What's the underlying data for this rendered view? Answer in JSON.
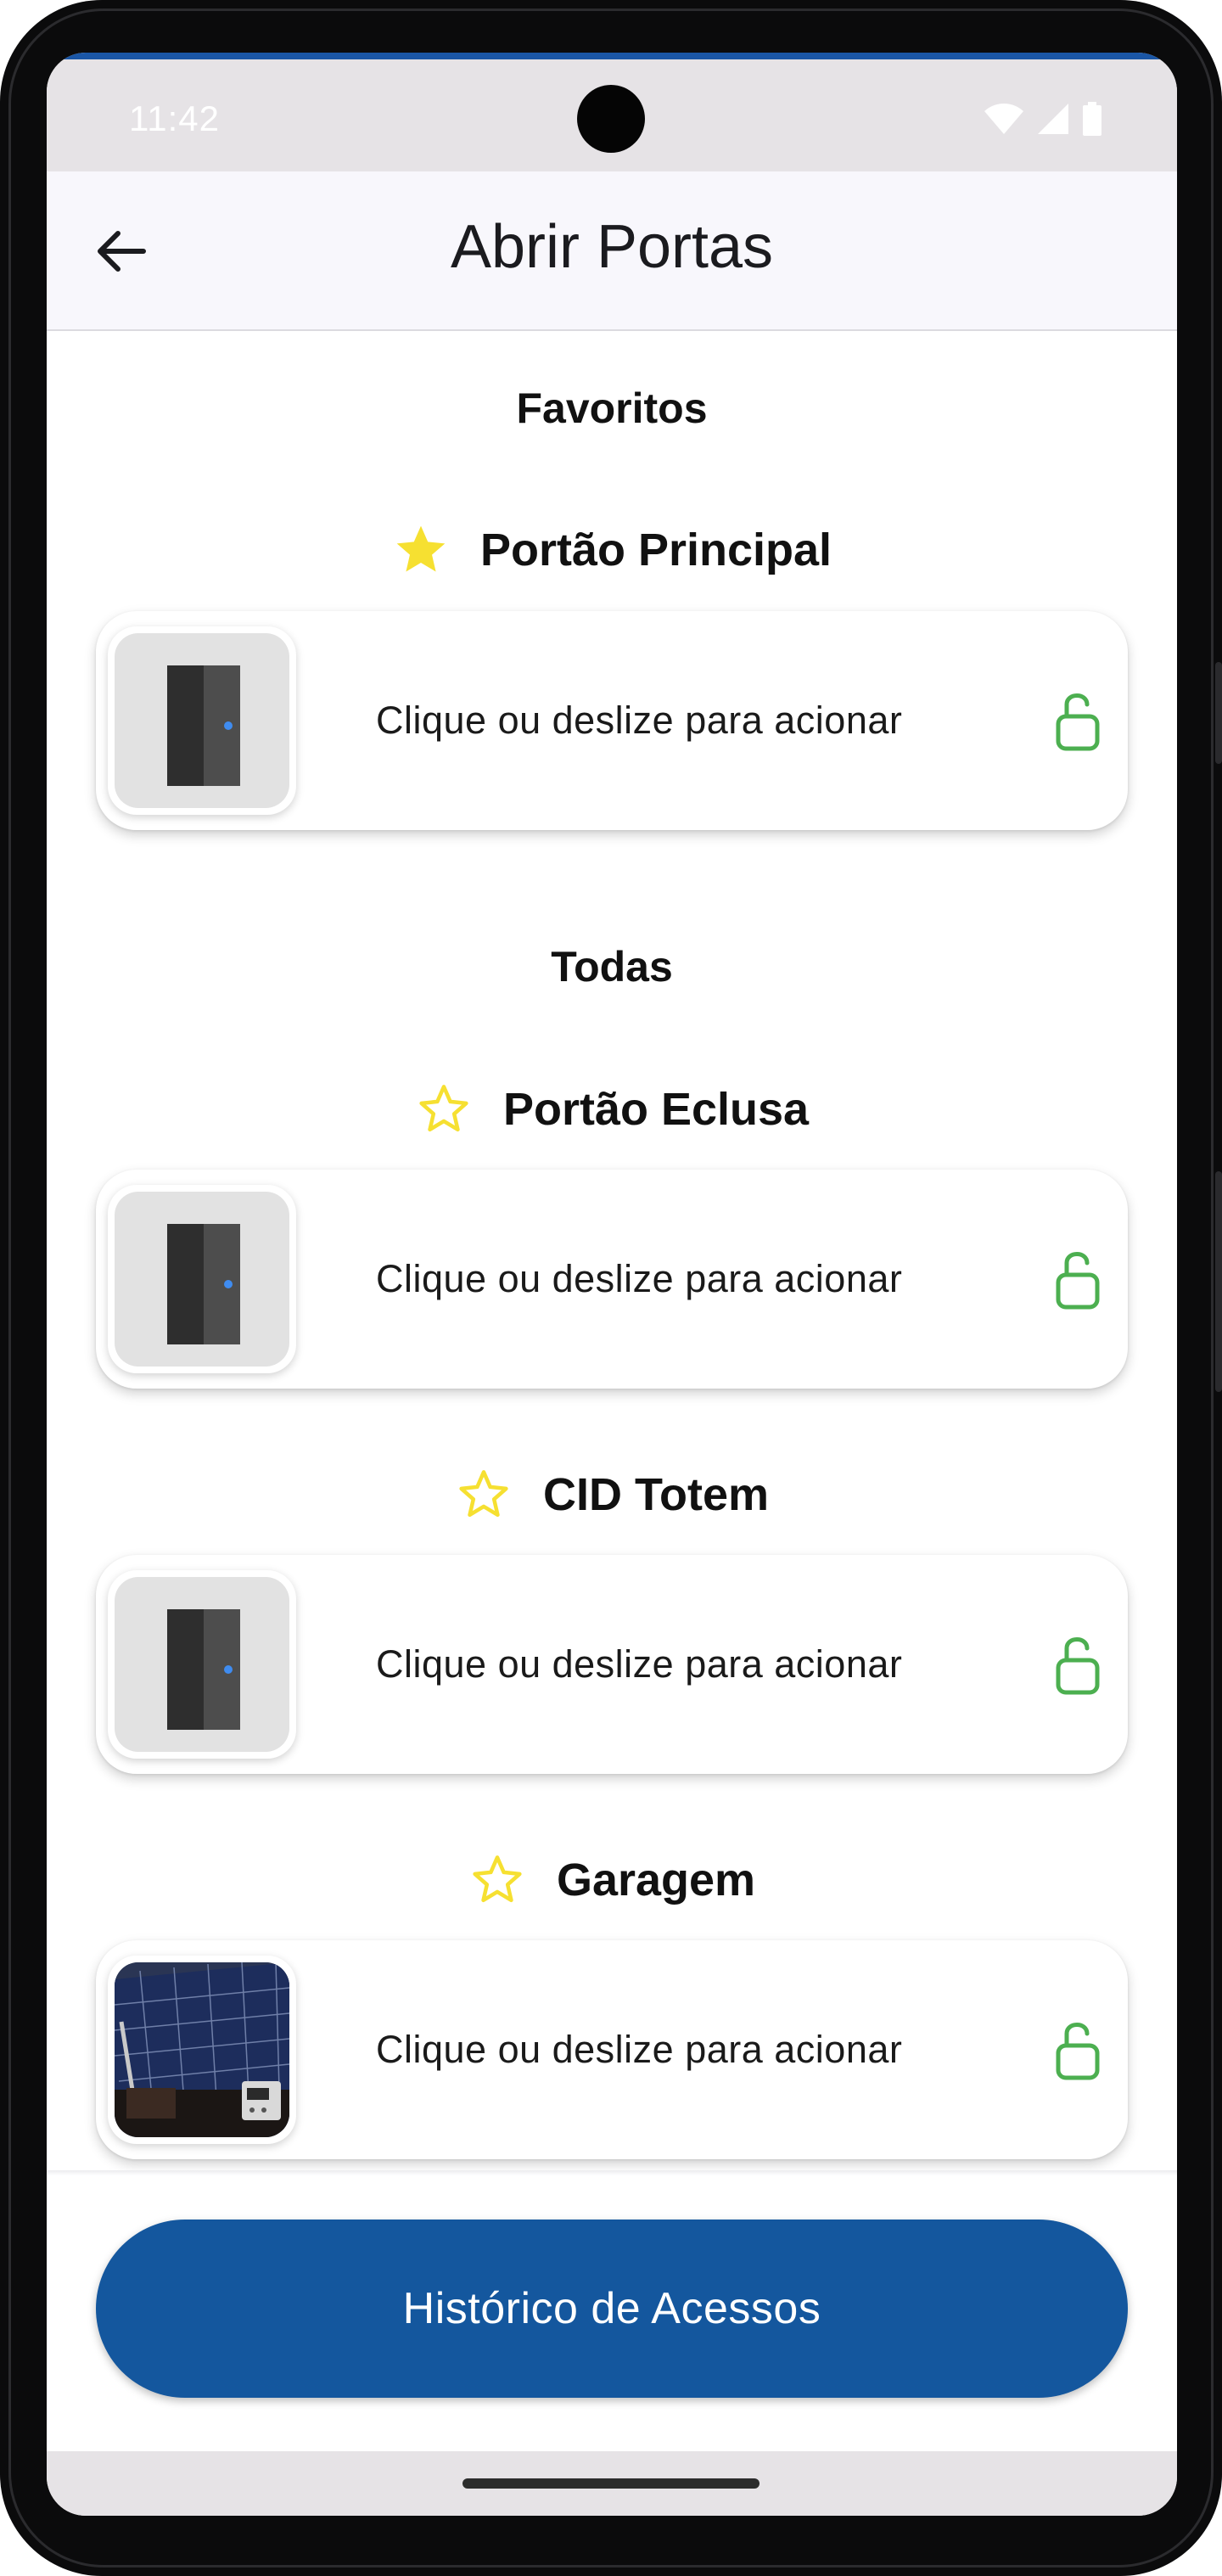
{
  "status_bar": {
    "time": "11:42"
  },
  "app_bar": {
    "title": "Abrir Portas"
  },
  "favorites_section": {
    "title": "Favoritos",
    "doors": [
      {
        "name": "Portão Principal",
        "favorite": true,
        "thumbnail": "door-icon",
        "action_label": "Clique ou deslize para acionar"
      }
    ]
  },
  "all_section": {
    "title": "Todas",
    "doors": [
      {
        "name": "Portão Eclusa",
        "favorite": false,
        "thumbnail": "door-icon",
        "action_label": "Clique ou deslize para acionar"
      },
      {
        "name": "CID Totem",
        "favorite": false,
        "thumbnail": "door-icon",
        "action_label": "Clique ou deslize para acionar"
      },
      {
        "name": "Garagem",
        "favorite": false,
        "thumbnail": "solar-panel-photo",
        "action_label": "Clique ou deslize para acionar"
      }
    ]
  },
  "history_button": {
    "label": "Histórico de Acessos"
  },
  "colors": {
    "primary": "#14579e",
    "star": "#f6e031",
    "unlock": "#4caf50",
    "door_dot": "#3f8cf0"
  }
}
